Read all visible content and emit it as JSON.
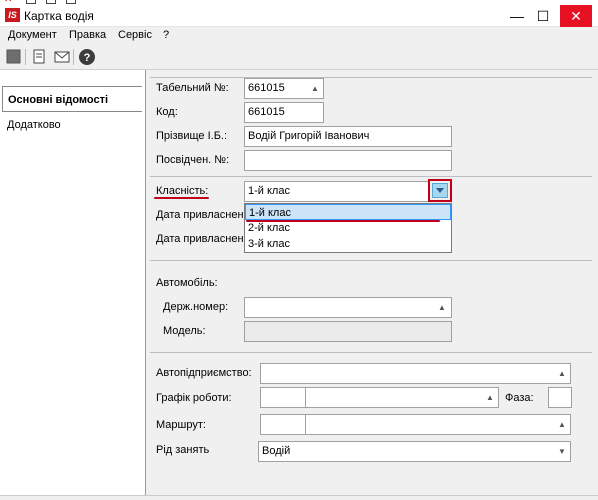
{
  "window": {
    "app_logo": "IS",
    "title": "Картка водія",
    "minimize": "—",
    "maximize": "☐",
    "close": "✕"
  },
  "menu": [
    "Документ",
    "Правка",
    "Сервіс",
    "?"
  ],
  "toolbar_icons": [
    "save-icon",
    "document-icon",
    "mail-icon",
    "help-icon"
  ],
  "sidebar": {
    "items": [
      {
        "label": "Основні відомості"
      },
      {
        "label": "Додатково"
      }
    ]
  },
  "form": {
    "tab_number_label": "Табельний №:",
    "tab_number_value": "661015",
    "code_label": "Код:",
    "code_value": "661015",
    "name_label": "Прізвище І.Б.:",
    "name_value": "Водій Григорій Іванович",
    "license_label": "Посвідчен. №:",
    "license_value": "",
    "class_label": "Класність:",
    "class_value": "1-й клас",
    "class_options": [
      "1-й клас",
      "2-й клас",
      "3-й клас"
    ],
    "date1_label": "Дата привласнен",
    "date2_label": "Дата привласнен",
    "car_section_label": "Автомобіль:",
    "plate_label": "Держ.номер:",
    "plate_value": "",
    "model_label": "Модель:",
    "model_value": "",
    "company_label": "Автопідприємство:",
    "company_value": "",
    "schedule_label": "Графік роботи:",
    "phase_label": "Фаза:",
    "route_label": "Маршрут:",
    "occupation_label": "Рід занять",
    "occupation_value": "Водій"
  },
  "colors": {
    "accent_red": "#c0001a",
    "selection": "#cce4f7",
    "highlight_border": "#3399ff"
  }
}
